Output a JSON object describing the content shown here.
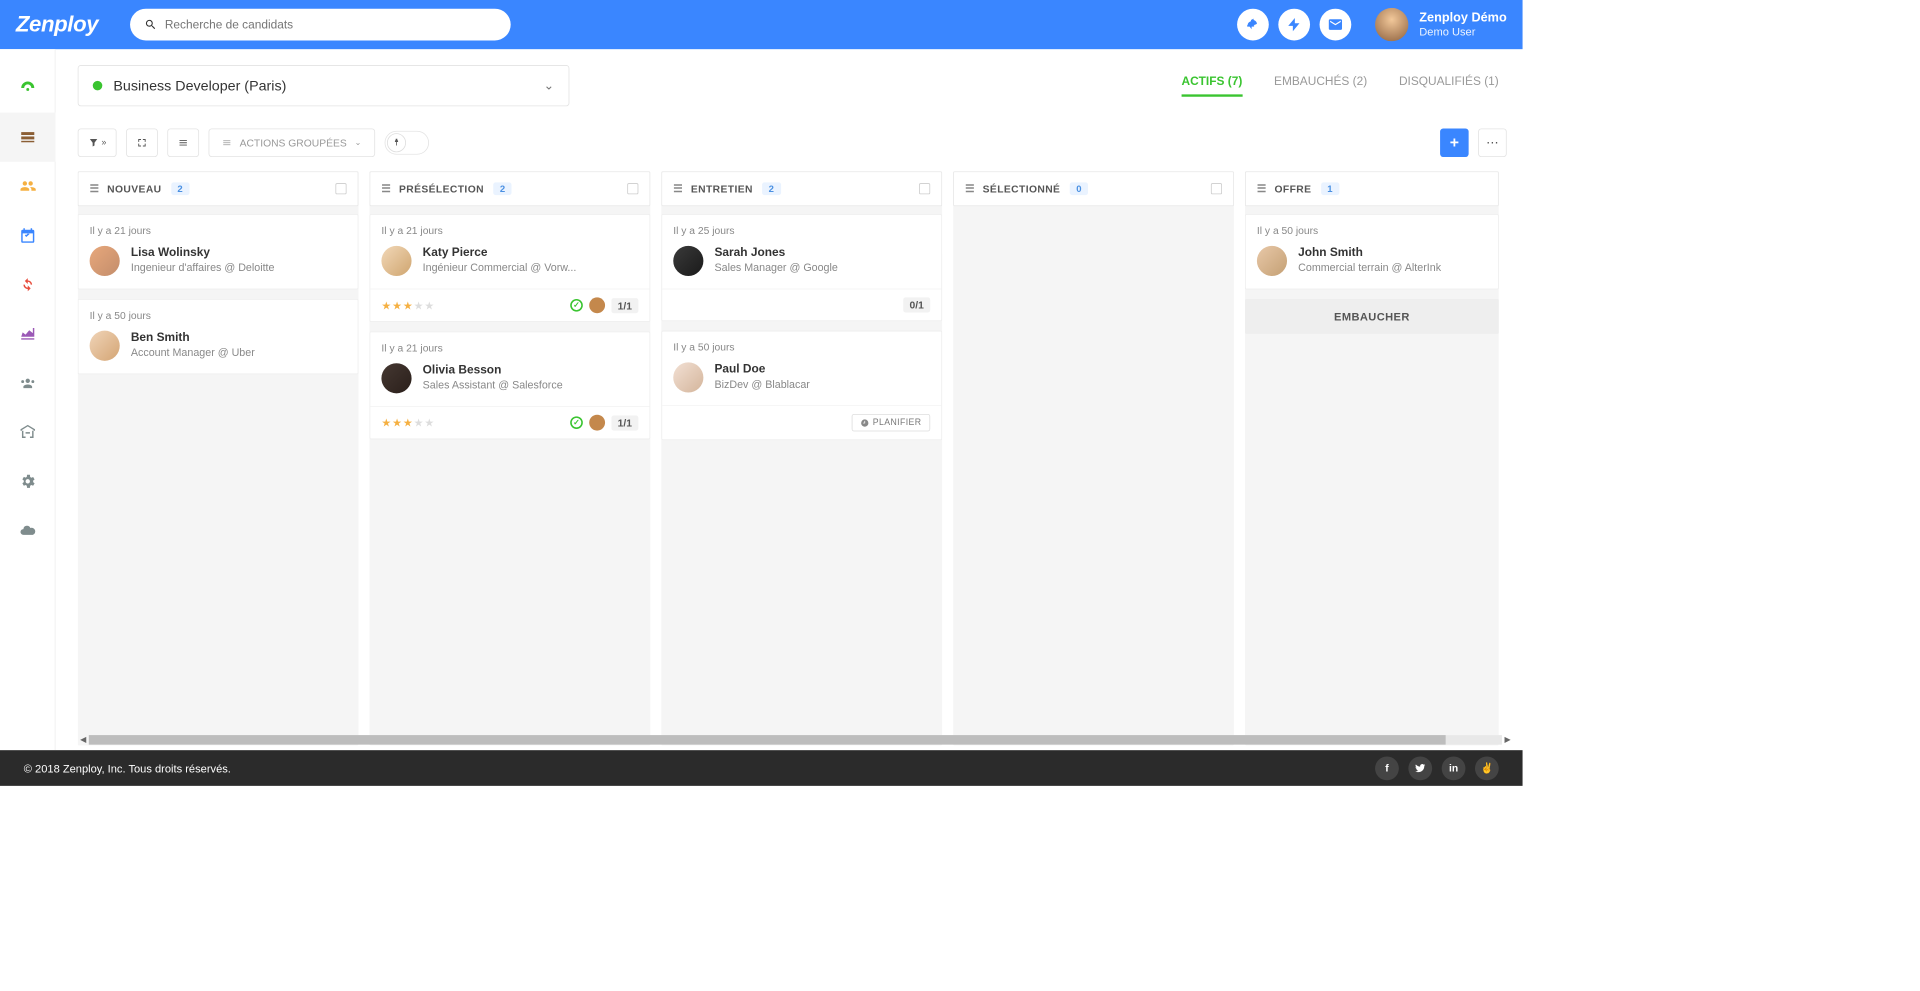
{
  "header": {
    "logo": "Zenploy",
    "search_placeholder": "Recherche de candidats",
    "user_title": "Zenploy Démo",
    "user_sub": "Demo User"
  },
  "job": {
    "title": "Business Developer (Paris)"
  },
  "tabs": {
    "active": {
      "label": "ACTIFS",
      "count": "(7)"
    },
    "hired": {
      "label": "EMBAUCHÉS",
      "count": "(2)"
    },
    "disq": {
      "label": "DISQUALIFIÉS",
      "count": "(1)"
    }
  },
  "toolbar": {
    "group_actions": "ACTIONS GROUPÉES"
  },
  "columns": {
    "nouveau": {
      "title": "NOUVEAU",
      "count": "2"
    },
    "preselection": {
      "title": "PRÉSÉLECTION",
      "count": "2"
    },
    "entretien": {
      "title": "ENTRETIEN",
      "count": "2"
    },
    "selectionne": {
      "title": "SÉLECTIONNÉ",
      "count": "0"
    },
    "offre": {
      "title": "OFFRE",
      "count": "1"
    }
  },
  "cards": {
    "c1": {
      "time": "Il y a 21 jours",
      "name": "Lisa Wolinsky",
      "sub": "Ingenieur d'affaires @ Deloitte"
    },
    "c2": {
      "time": "Il y a 50 jours",
      "name": "Ben Smith",
      "sub": "Account Manager @ Uber"
    },
    "c3": {
      "time": "Il y a 21 jours",
      "name": "Katy Pierce",
      "sub": "Ingénieur Commercial @ Vorw...",
      "ratio": "1/1"
    },
    "c4": {
      "time": "Il y a 21 jours",
      "name": "Olivia Besson",
      "sub": "Sales Assistant @ Salesforce",
      "ratio": "1/1"
    },
    "c5": {
      "time": "Il y a 25 jours",
      "name": "Sarah Jones",
      "sub": "Sales Manager @ Google",
      "ratio": "0/1"
    },
    "c6": {
      "time": "Il y a 50 jours",
      "name": "Paul Doe",
      "sub": "BizDev @ Blablacar",
      "plan": "PLANIFIER"
    },
    "c7": {
      "time": "Il y a 50 jours",
      "name": "John Smith",
      "sub": "Commercial terrain @ AlterInk"
    }
  },
  "hire_button": "EMBAUCHER",
  "footer": {
    "copyright": "© 2018 Zenploy, Inc. Tous droits réservés."
  }
}
